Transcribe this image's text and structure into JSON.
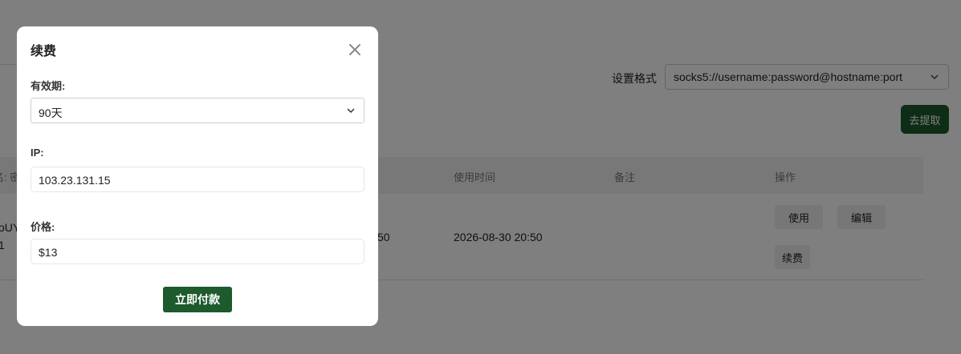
{
  "background": {
    "format_label": "设置格式",
    "format_value": "socks5://username:password@hostname:port",
    "extract_button": "去提取",
    "table": {
      "headers": [
        "名: 密",
        "使用时间",
        "备注",
        "操作"
      ],
      "row": {
        "name_partial_1": "oUY",
        "name_partial_2": "1",
        "time_partial": "50",
        "use_time": "2026-08-30 20:50",
        "remark": "",
        "actions": [
          "使用",
          "编辑",
          "续费"
        ]
      }
    }
  },
  "modal": {
    "title": "续费",
    "validity_label": "有效期:",
    "validity_value": "90天",
    "ip_label": "IP:",
    "ip_value": "103.23.131.15",
    "price_label": "价格:",
    "price_value": "$13",
    "pay_button": "立即付款"
  },
  "colors": {
    "brand_green": "#1d5a2d",
    "overlay": "rgba(0,0,0,0.5)"
  }
}
